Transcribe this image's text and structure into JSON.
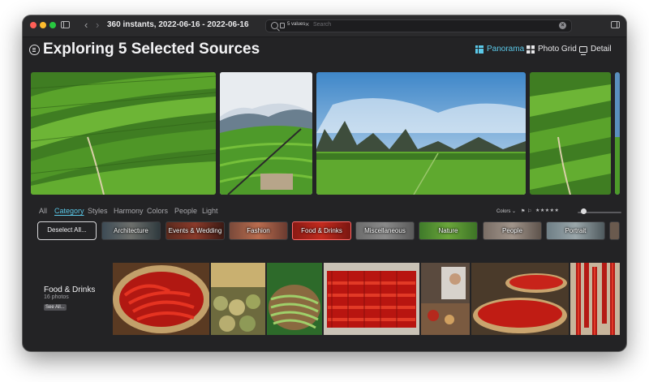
{
  "window": {
    "title": "360 instants, 2022-06-16 - 2022-06-16",
    "search": {
      "token": "5 values",
      "placeholder": "Search"
    }
  },
  "header": {
    "title": "Exploring 5 Selected Sources",
    "views": [
      {
        "label": "Panorama",
        "active": true,
        "icon": "panorama-icon"
      },
      {
        "label": "Photo Grid",
        "active": false,
        "icon": "grid-icon"
      },
      {
        "label": "Detail",
        "active": false,
        "icon": "detail-icon"
      }
    ]
  },
  "filters": {
    "tabs": [
      "All",
      "Category",
      "Styles",
      "Harmony",
      "Colors",
      "People",
      "Light"
    ],
    "active_tab": "Category",
    "colors_dropdown": "Colors",
    "stars": "★★★★★"
  },
  "categories": {
    "deselect_label": "Deselect All...",
    "chips": [
      {
        "label": "Architecture",
        "selected": false
      },
      {
        "label": "Events & Wedding",
        "selected": false
      },
      {
        "label": "Fashion",
        "selected": false
      },
      {
        "label": "Food & Drinks",
        "selected": true
      },
      {
        "label": "Miscellaneous",
        "selected": false
      },
      {
        "label": "Nature",
        "selected": false
      },
      {
        "label": "People",
        "selected": false
      },
      {
        "label": "Portrait",
        "selected": false
      }
    ]
  },
  "group": {
    "title": "Food & Drinks",
    "count": "16 photos",
    "see_all": "See All..."
  },
  "colors": {
    "accent": "#5bc8e8",
    "window_bg": "#232325",
    "selected_chip_border": "#ff6a6a"
  }
}
